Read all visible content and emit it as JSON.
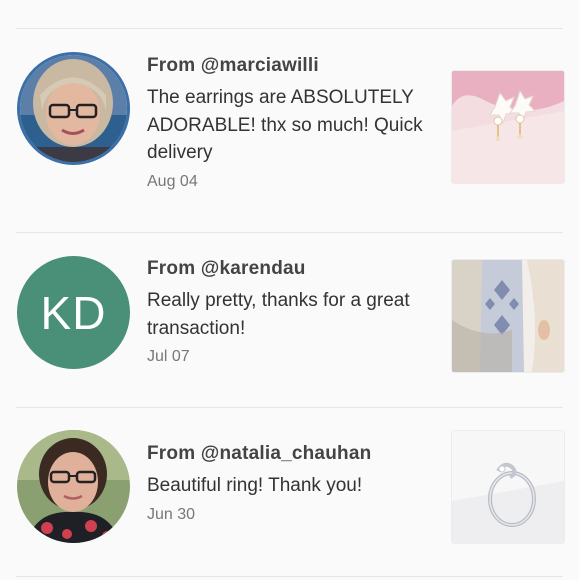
{
  "reviews": [
    {
      "from": "From @marciawilli",
      "text": "The earrings are ABSOLUTELY ADORABLE! thx so much! Quick delivery",
      "date": "Aug 04",
      "avatar": "photo",
      "thumb": "earrings"
    },
    {
      "from": "From @karendau",
      "text": "Really pretty, thanks for a great transaction!",
      "date": "Jul 07",
      "avatar_initials": "KD",
      "avatar_color": "#4a9079",
      "thumb": "scarf"
    },
    {
      "from": "From @natalia_chauhan",
      "text": "Beautiful ring! Thank you!",
      "date": "Jun 30",
      "avatar": "photo",
      "thumb": "ring"
    }
  ]
}
